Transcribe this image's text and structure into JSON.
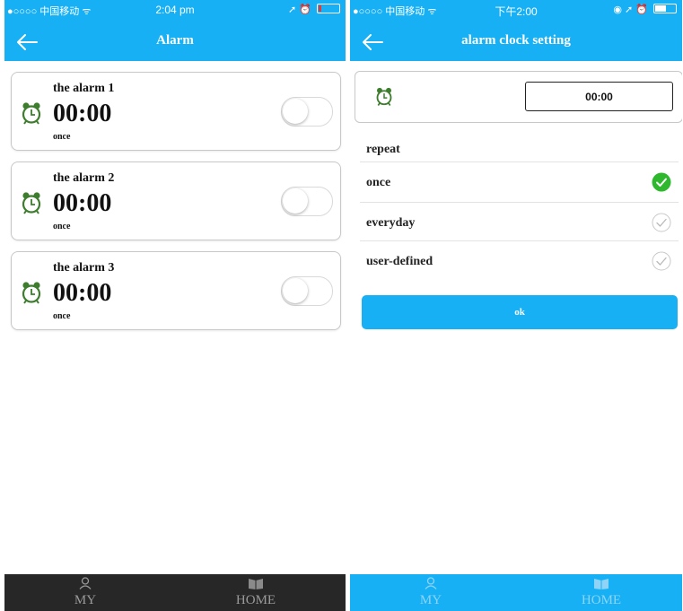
{
  "alarm_screen": {
    "status": {
      "carrier": "●○○○○ 中国移动 ᯤ",
      "time": "2:04 pm",
      "right_icons": "➚ ⏰"
    },
    "header": {
      "title": "Alarm"
    },
    "alarms": [
      {
        "name": "the alarm 1",
        "time": "00:00",
        "repeat": "once",
        "enabled": false
      },
      {
        "name": "the alarm 2",
        "time": "00:00",
        "repeat": "once",
        "enabled": false
      },
      {
        "name": "the alarm 3",
        "time": "00:00",
        "repeat": "once",
        "enabled": false
      }
    ],
    "tabbar": {
      "my_label": "MY",
      "home_label": "HOME"
    }
  },
  "setting_screen": {
    "status": {
      "carrier": "●○○○○ 中国移动 ᯤ",
      "time": "下午2:00",
      "right_icons": "◉ ➚ ⏰"
    },
    "header": {
      "title": "alarm clock setting"
    },
    "time_value": "00:00",
    "repeat_label": "repeat",
    "options": [
      {
        "label": "once",
        "selected": true
      },
      {
        "label": "everyday",
        "selected": false
      },
      {
        "label": "user-defined",
        "selected": false
      }
    ],
    "ok_label": "ok",
    "tabbar": {
      "my_label": "MY",
      "home_label": "HOME"
    }
  },
  "colors": {
    "accent": "#17b0f4",
    "check_green": "#2eb82e",
    "clock_green": "#3e7d2e",
    "dark_tabbar": "#272727"
  },
  "icons": [
    "back-arrow-icon",
    "alarm-clock-icon",
    "person-icon",
    "book-icon",
    "checkmark-icon",
    "battery-icon",
    "wifi-icon"
  ]
}
